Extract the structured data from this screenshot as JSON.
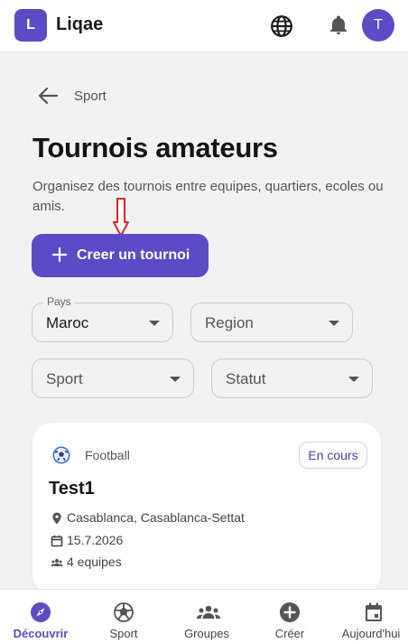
{
  "header": {
    "logo_letter": "L",
    "brand": "Liqae",
    "avatar_letter": "T"
  },
  "breadcrumb": {
    "label": "Sport"
  },
  "page": {
    "title": "Tournois amateurs",
    "subtitle": "Organisez des tournois entre equipes, quartiers, ecoles ou amis."
  },
  "cta": {
    "label": "Creer un tournoi"
  },
  "filters": {
    "country": {
      "legend": "Pays",
      "value": "Maroc"
    },
    "region": {
      "placeholder": "Region"
    },
    "sport": {
      "placeholder": "Sport"
    },
    "status": {
      "placeholder": "Statut"
    }
  },
  "tournaments": [
    {
      "sport": "Football",
      "status": "En cours",
      "name": "Test1",
      "location": "Casablanca, Casablanca-Settat",
      "date": "15.7.2026",
      "teams": "4 equipes"
    }
  ],
  "nav": [
    {
      "label": "Découvrir",
      "icon": "compass-icon",
      "active": true
    },
    {
      "label": "Sport",
      "icon": "soccer-ball-icon",
      "active": false
    },
    {
      "label": "Groupes",
      "icon": "group-icon",
      "active": false
    },
    {
      "label": "Créer",
      "icon": "plus-circle-icon",
      "active": false
    },
    {
      "label": "Aujourd'hui",
      "icon": "calendar-icon",
      "active": false
    }
  ],
  "colors": {
    "accent": "#5b4bc4",
    "annotation_arrow": "#e0242b",
    "background": "#f2f2f4"
  }
}
